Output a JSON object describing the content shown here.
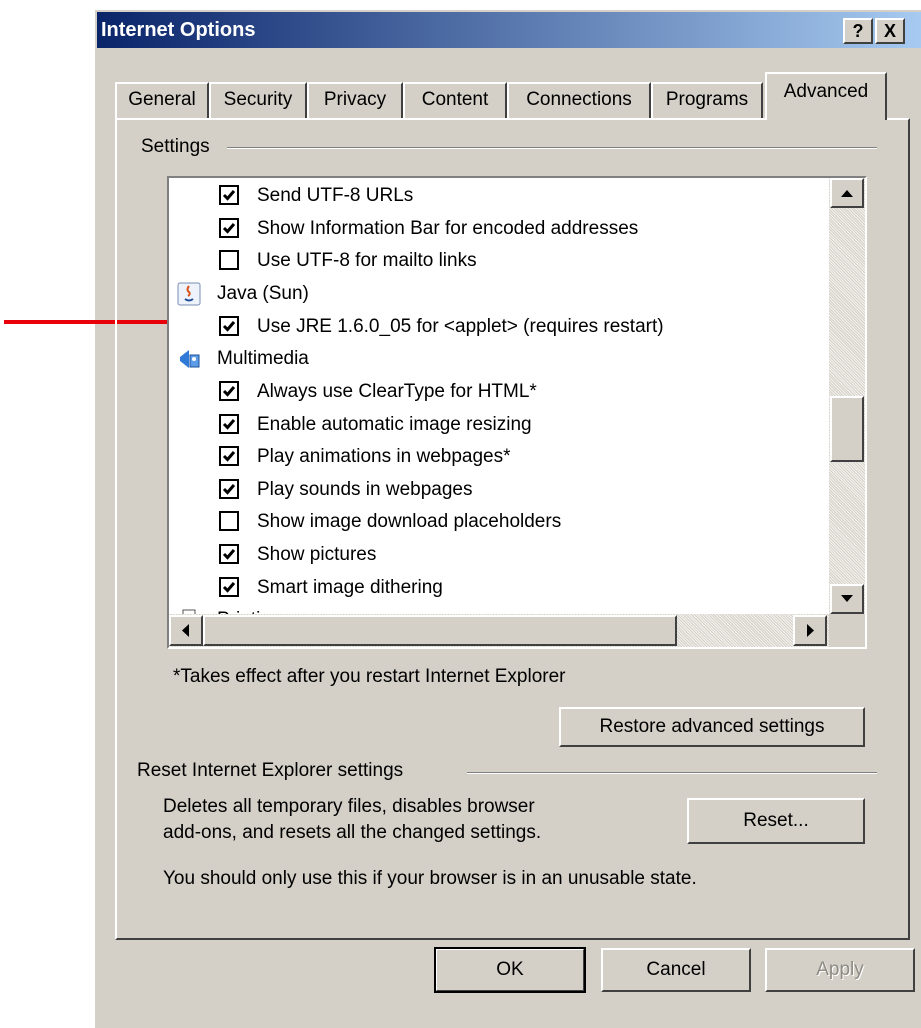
{
  "window": {
    "title": "Internet Options",
    "help_glyph": "?",
    "close_glyph": "X"
  },
  "tabs": [
    {
      "label": "General",
      "active": false
    },
    {
      "label": "Security",
      "active": false
    },
    {
      "label": "Privacy",
      "active": false
    },
    {
      "label": "Content",
      "active": false
    },
    {
      "label": "Connections",
      "active": false
    },
    {
      "label": "Programs",
      "active": false
    },
    {
      "label": "Advanced",
      "active": true
    }
  ],
  "settings": {
    "group_label": "Settings",
    "items": [
      {
        "type": "checkbox",
        "label": "Send UTF-8 URLs",
        "checked": true
      },
      {
        "type": "checkbox",
        "label": "Show Information Bar for encoded addresses",
        "checked": true
      },
      {
        "type": "checkbox",
        "label": "Use UTF-8 for mailto links",
        "checked": false
      },
      {
        "type": "category",
        "label": "Java (Sun)",
        "icon": "java-icon"
      },
      {
        "type": "checkbox",
        "label": "Use JRE 1.6.0_05 for <applet> (requires restart)",
        "checked": true
      },
      {
        "type": "category",
        "label": "Multimedia",
        "icon": "multimedia-icon"
      },
      {
        "type": "checkbox",
        "label": "Always use ClearType for HTML*",
        "checked": true
      },
      {
        "type": "checkbox",
        "label": "Enable automatic image resizing",
        "checked": true
      },
      {
        "type": "checkbox",
        "label": "Play animations in webpages*",
        "checked": true
      },
      {
        "type": "checkbox",
        "label": "Play sounds in webpages",
        "checked": true
      },
      {
        "type": "checkbox",
        "label": "Show image download placeholders",
        "checked": false
      },
      {
        "type": "checkbox",
        "label": "Show pictures",
        "checked": true
      },
      {
        "type": "checkbox",
        "label": "Smart image dithering",
        "checked": true
      },
      {
        "type": "category",
        "label": "Printing",
        "icon": "printer-icon"
      }
    ],
    "note": "*Takes effect after you restart Internet Explorer",
    "restore_button": "Restore advanced settings"
  },
  "reset": {
    "group_label": "Reset Internet Explorer settings",
    "description_line1": "Deletes all temporary files, disables browser",
    "description_line2": "add-ons, and resets all the changed settings.",
    "button": "Reset...",
    "warning": "You should only use this if your browser is in an unusable state."
  },
  "footer": {
    "ok": "OK",
    "cancel": "Cancel",
    "apply": "Apply"
  },
  "colors": {
    "dialog_face": "#d4d0c8",
    "titlebar_start": "#0a246a",
    "titlebar_end": "#a6caf0",
    "annotation_arrow": "#e8000b"
  }
}
